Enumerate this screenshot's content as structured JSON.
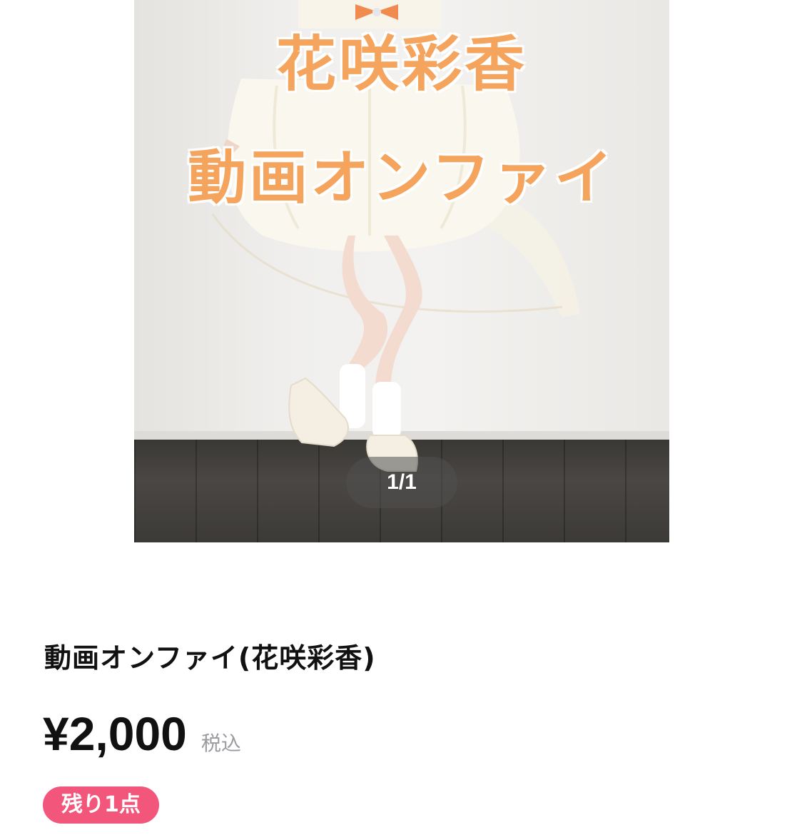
{
  "carousel": {
    "overlay_line1": "花咲彩香",
    "overlay_line2": "動画オンファイ",
    "pager": "1/1",
    "overlay_color": "#f4a45c"
  },
  "product": {
    "title": "動画オンファイ(花咲彩香)",
    "price": "¥2,000",
    "tax_label": "税込",
    "stock_badge": "残り1点",
    "badge_color": "#f2567a"
  }
}
